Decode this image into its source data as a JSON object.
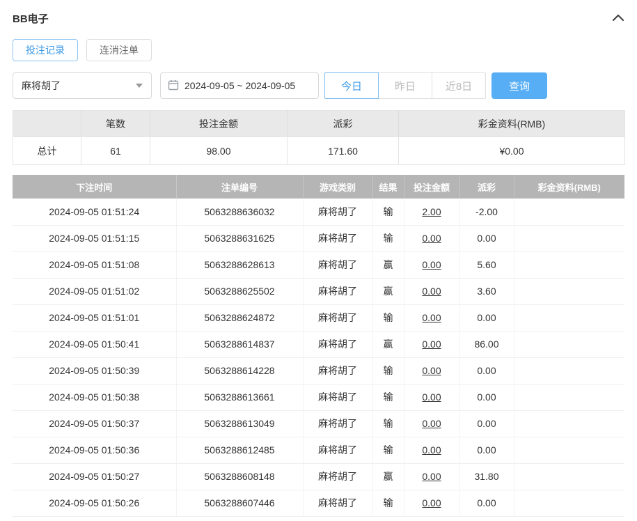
{
  "colors": {
    "accent": "#3d9be8",
    "accent_bg": "#57aef5",
    "negative": "#e9573f",
    "table_header_gray": "#b5b5b5",
    "summary_header_gray": "#e9e9e9"
  },
  "header": {
    "title": "BB电子"
  },
  "tabs": [
    {
      "label": "投注记录",
      "active": true
    },
    {
      "label": "连消注单",
      "active": false
    }
  ],
  "filters": {
    "game_select_value": "麻将胡了",
    "date_range_value": "2024-09-05 ~ 2024-09-05",
    "quick_buttons": [
      {
        "label": "今日",
        "active": true
      },
      {
        "label": "昨日",
        "active": false
      },
      {
        "label": "近8日",
        "active": false
      }
    ],
    "search_label": "查询"
  },
  "summary": {
    "headers": [
      "",
      "笔数",
      "投注金额",
      "派彩",
      "彩金资料(RMB)"
    ],
    "row": {
      "label": "总计",
      "count": "61",
      "bet_total": "98.00",
      "payout_total": "171.60",
      "bonus_total": "¥0.00"
    }
  },
  "table": {
    "headers": [
      "下注时间",
      "注单编号",
      "游戏类别",
      "结果",
      "投注金额",
      "派彩",
      "彩金资料(RMB)"
    ],
    "rows": [
      {
        "time": "2024-09-05 01:51:24",
        "order_id": "5063288636032",
        "game": "麻将胡了",
        "result": "输",
        "bet": "2.00",
        "payout": "-2.00",
        "bonus": ""
      },
      {
        "time": "2024-09-05 01:51:15",
        "order_id": "5063288631625",
        "game": "麻将胡了",
        "result": "输",
        "bet": "0.00",
        "payout": "0.00",
        "bonus": ""
      },
      {
        "time": "2024-09-05 01:51:08",
        "order_id": "5063288628613",
        "game": "麻将胡了",
        "result": "赢",
        "bet": "0.00",
        "payout": "5.60",
        "bonus": ""
      },
      {
        "time": "2024-09-05 01:51:02",
        "order_id": "5063288625502",
        "game": "麻将胡了",
        "result": "赢",
        "bet": "0.00",
        "payout": "3.60",
        "bonus": ""
      },
      {
        "time": "2024-09-05 01:51:01",
        "order_id": "5063288624872",
        "game": "麻将胡了",
        "result": "输",
        "bet": "0.00",
        "payout": "0.00",
        "bonus": ""
      },
      {
        "time": "2024-09-05 01:50:41",
        "order_id": "5063288614837",
        "game": "麻将胡了",
        "result": "赢",
        "bet": "0.00",
        "payout": "86.00",
        "bonus": ""
      },
      {
        "time": "2024-09-05 01:50:39",
        "order_id": "5063288614228",
        "game": "麻将胡了",
        "result": "输",
        "bet": "0.00",
        "payout": "0.00",
        "bonus": ""
      },
      {
        "time": "2024-09-05 01:50:38",
        "order_id": "5063288613661",
        "game": "麻将胡了",
        "result": "输",
        "bet": "0.00",
        "payout": "0.00",
        "bonus": ""
      },
      {
        "time": "2024-09-05 01:50:37",
        "order_id": "5063288613049",
        "game": "麻将胡了",
        "result": "输",
        "bet": "0.00",
        "payout": "0.00",
        "bonus": ""
      },
      {
        "time": "2024-09-05 01:50:36",
        "order_id": "5063288612485",
        "game": "麻将胡了",
        "result": "输",
        "bet": "0.00",
        "payout": "0.00",
        "bonus": ""
      },
      {
        "time": "2024-09-05 01:50:27",
        "order_id": "5063288608148",
        "game": "麻将胡了",
        "result": "赢",
        "bet": "0.00",
        "payout": "31.80",
        "bonus": ""
      },
      {
        "time": "2024-09-05 01:50:26",
        "order_id": "5063288607446",
        "game": "麻将胡了",
        "result": "输",
        "bet": "0.00",
        "payout": "0.00",
        "bonus": ""
      }
    ]
  }
}
